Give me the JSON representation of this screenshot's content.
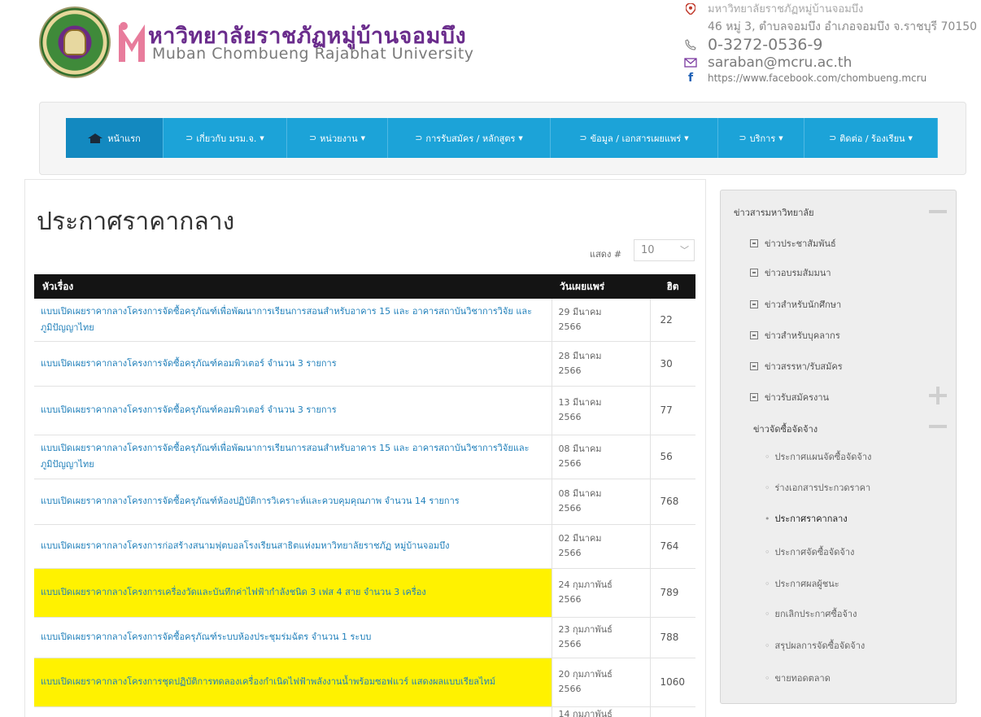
{
  "header": {
    "logo_th": "หาวิทยาลัยราชภัฏหมู่บ้านจอมบึง",
    "logo_en": "Muban Chombueng Rajabhat University",
    "address_line1": "มหาวิทยาลัยราชภัฏหมู่บ้านจอมบึง",
    "address_line2": "46 หมู่ 3, ตำบลจอมบึง อำเภอจอมบึง จ.ราชบุรี 70150",
    "phone": "0-3272-0536-9",
    "email": "saraban@mcru.ac.th",
    "facebook": "https://www.facebook.com/chombueng.mcru"
  },
  "nav": {
    "items": [
      {
        "label": "หน้าแรก"
      },
      {
        "label": "เกี่ยวกับ มรม.จ."
      },
      {
        "label": "หน่วยงาน"
      },
      {
        "label": "การรับสมัคร / หลักสูตร"
      },
      {
        "label": "ข้อมูล / เอกสารเผยแพร่"
      },
      {
        "label": "บริการ"
      },
      {
        "label": "ติดต่อ / ร้องเรียน"
      }
    ]
  },
  "main": {
    "title": "ประกาศราคากลาง",
    "show_label": "แสดง #",
    "show_value": "10",
    "columns": {
      "title": "หัวเรื่อง",
      "date": "วันเผยแพร่",
      "hits": "ฮิต"
    },
    "rows": [
      {
        "title": "แบบเปิดเผยราคากลางโครงการจัดซื้อครุภัณฑ์เพื่อพัฒนาการเรียนการสอนสำหรับอาคาร 15 และ อาคารสถาบันวิชาการวิจัย และภูมิปัญญาไทย",
        "date_line1": "29 มีนาคม",
        "date_line2": "2566",
        "hits": "22"
      },
      {
        "title": "แบบเปิดเผยราคากลางโครงการจัดซื้อครุภัณฑ์คอมพิวเตอร์ จำนวน 3 รายการ",
        "date_line1": "28 มีนาคม",
        "date_line2": "2566",
        "hits": "30"
      },
      {
        "title": "แบบเปิดเผยราคากลางโครงการจัดซื้อครุภัณฑ์คอมพิวเตอร์ จำนวน 3 รายการ",
        "date_line1": "13 มีนาคม",
        "date_line2": "2566",
        "hits": "77"
      },
      {
        "title": "แบบเปิดเผยราคากลางโครงการจัดซื้อครุภัณฑ์เพื่อพัฒนาการเรียนการสอนสำหรับอาคาร 15 และ อาคารสถาบันวิชาการวิจัยและภูมิปัญญาไทย",
        "date_line1": "08 มีนาคม",
        "date_line2": "2566",
        "hits": "56"
      },
      {
        "title": "แบบเปิดเผยราคากลางโครงการจัดซื้อครุภัณฑ์ห้องปฏิบัติการวิเคราะห์และควบคุมคุณภาพ จำนวน 14 รายการ",
        "date_line1": "08 มีนาคม",
        "date_line2": "2566",
        "hits": "768"
      },
      {
        "title": "แบบเปิดเผยราคากลางโครงการก่อสร้างสนามฟุตบอลโรงเรียนสาธิตแห่งมหาวิทยาลัยราชภัฏ หมู่บ้านจอมบึง",
        "date_line1": "02 มีนาคม",
        "date_line2": "2566",
        "hits": "764"
      },
      {
        "title": "แบบเปิดเผยราคากลางโครงการเครื่องวัดและบันทึกค่าไฟฟ้ากำลังชนิด 3 เฟส 4 สาย จำนวน 3 เครื่อง",
        "date_line1": "24 กุมภาพันธ์",
        "date_line2": "2566",
        "hits": "789",
        "highlight": true
      },
      {
        "title": "แบบเปิดเผยราคากลางโครงการจัดซื้อครุภัณฑ์ระบบห้องประชุมร่มฉัตร จำนวน 1 ระบบ",
        "date_line1": "23 กุมภาพันธ์",
        "date_line2": "2566",
        "hits": "788"
      },
      {
        "title": "แบบเปิดเผยราคากลางโครงการชุดปฏิบัติการทดลองเครื่องกำเนิดไฟฟ้าพลังงานน้ำพร้อมซอฟแวร์ แสดงผลแบบเรียลไทม์",
        "date_line1": "20 กุมภาพันธ์",
        "date_line2": "2566",
        "hits": "1060",
        "highlight": true
      },
      {
        "title": "",
        "date_line1": "14 กุมภาพันธ์",
        "date_line2": "",
        "hits": ""
      }
    ]
  },
  "sidebar": {
    "heading": "ข่าวสารมหาวิทยาลัย",
    "categories": [
      {
        "label": "ข่าวประชาสัมพันธ์"
      },
      {
        "label": "ข่าวอบรมสัมมนา"
      },
      {
        "label": "ข่าวสำหรับนักศึกษา"
      },
      {
        "label": "ข่าวสำหรับบุคลากร"
      },
      {
        "label": "ข่าวสรรหา/รับสมัคร"
      },
      {
        "label": "ข่าวรับสมัครงาน"
      }
    ],
    "procurement_heading": "ข่าวจัดซื้อจัดจ้าง",
    "procurement_items": [
      {
        "label": "ประกาศแผนจัดซื้อจัดจ้าง"
      },
      {
        "label": "ร่างเอกสารประกวดราคา"
      },
      {
        "label": "ประกาศราคากลาง"
      },
      {
        "label": "ประกาศจัดซื้อจัดจ้าง"
      },
      {
        "label": "ประกาศผลผู้ชนะ"
      },
      {
        "label": "ยกเลิกประกาศซื้อจ้าง"
      },
      {
        "label": "สรุปผลการจัดซื้อจัดจ้าง"
      },
      {
        "label": "ขายทอดตลาด"
      }
    ]
  },
  "colors": {
    "brand_purple": "#6a2c8c",
    "nav_blue": "#1ca3d8",
    "nav_active": "#1389c0",
    "link_blue": "#1f7fba",
    "highlight_yellow": "#fff200",
    "table_header": "#141414"
  }
}
